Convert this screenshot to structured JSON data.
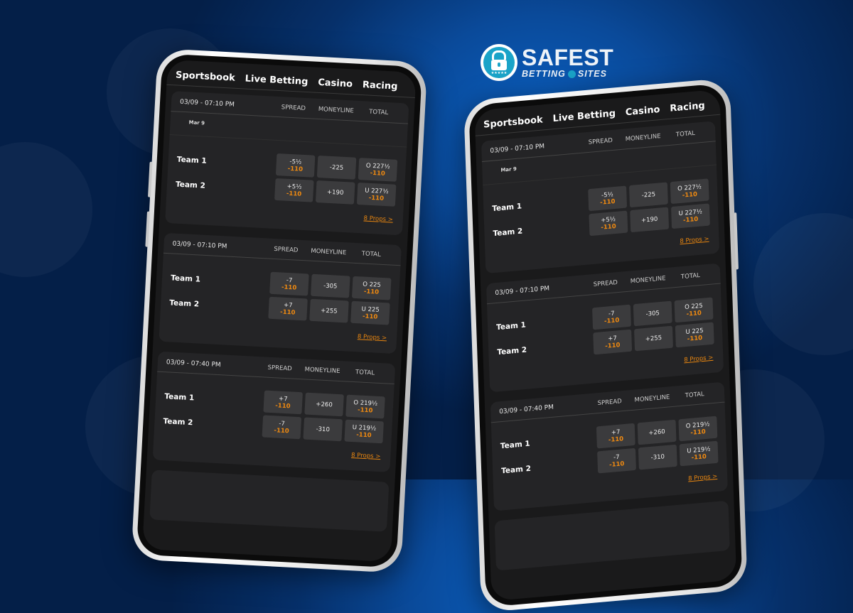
{
  "brand": {
    "name_main": "SAFEST",
    "name_sub_left": "BETTING",
    "name_sub_right": "SITES",
    "stars": "★★★★★",
    "accent_color": "#1aa3c8"
  },
  "colors": {
    "odds_orange": "#f08a10",
    "card_bg": "#242426",
    "odd_btn_bg": "#3b3b3d"
  },
  "nav": [
    "Sportsbook",
    "Live Betting",
    "Casino",
    "Racing"
  ],
  "columns": {
    "spread": "SPREAD",
    "moneyline": "MONEYLINE",
    "total": "TOTAL"
  },
  "games": [
    {
      "time": "03/09 - 07:10 PM",
      "date_label": "Mar 9",
      "teams": [
        {
          "name": "Team 1",
          "spread": "-5½",
          "spread_odds": "-110",
          "moneyline": "-225",
          "total": "O 227½",
          "total_odds": "-110"
        },
        {
          "name": "Team 2",
          "spread": "+5½",
          "spread_odds": "-110",
          "moneyline": "+190",
          "total": "U 227½",
          "total_odds": "-110"
        }
      ],
      "props": "8 Props >"
    },
    {
      "time": "03/09 - 07:10 PM",
      "teams": [
        {
          "name": "Team 1",
          "spread": "-7",
          "spread_odds": "-110",
          "moneyline": "-305",
          "total": "O 225",
          "total_odds": "-110"
        },
        {
          "name": "Team 2",
          "spread": "+7",
          "spread_odds": "-110",
          "moneyline": "+255",
          "total": "U 225",
          "total_odds": "-110"
        }
      ],
      "props": "8 Props >"
    },
    {
      "time": "03/09 - 07:40 PM",
      "teams": [
        {
          "name": "Team 1",
          "spread": "+7",
          "spread_odds": "-110",
          "moneyline": "+260",
          "total": "O 219½",
          "total_odds": "-110"
        },
        {
          "name": "Team 2",
          "spread": "-7",
          "spread_odds": "-110",
          "moneyline": "-310",
          "total": "U 219½",
          "total_odds": "-110"
        }
      ],
      "props": "8 Props >"
    }
  ]
}
